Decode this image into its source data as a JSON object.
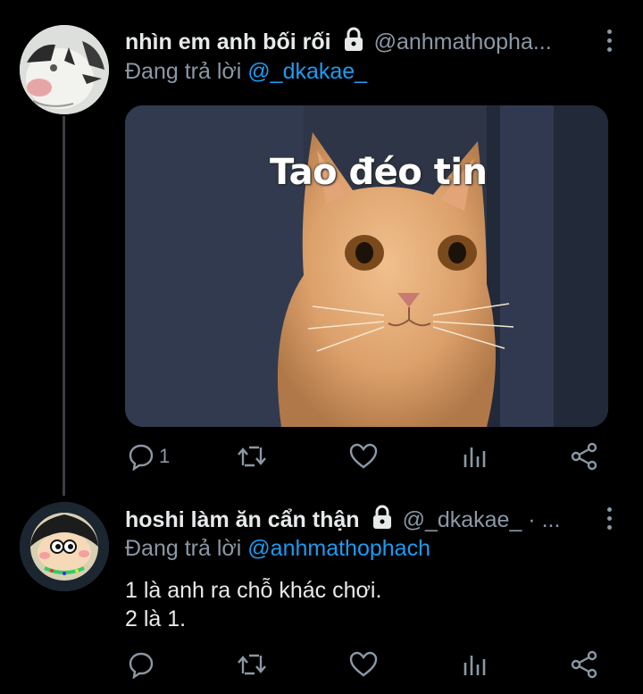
{
  "tweet1": {
    "name": "nhìn em anh bối rối",
    "handle": "@anhmathopha...",
    "reply_prefix": "Đang trả lời ",
    "reply_mention": "@_dkakae_",
    "media_caption": "Tao đéo tin",
    "reply_count": "1"
  },
  "tweet2": {
    "name": "hoshi làm ăn cẩn thận",
    "handle": "@_dkakae_ · ...",
    "reply_prefix": "Đang trả lời ",
    "reply_mention": "@anhmathophach",
    "text_lines": [
      "1 là anh ra chỗ khác chơi.",
      "2 là 1."
    ]
  },
  "icons": {
    "reply": "comment-icon",
    "retweet": "retweet-icon",
    "like": "heart-icon",
    "stats": "analytics-icon",
    "share": "share-icon",
    "lock": "lock-icon",
    "menu": "more-vertical-icon"
  },
  "colors": {
    "background": "#000000",
    "primary_text": "#e7e9ea",
    "secondary_text": "#8b98a5",
    "accent": "#1d9bf0"
  }
}
